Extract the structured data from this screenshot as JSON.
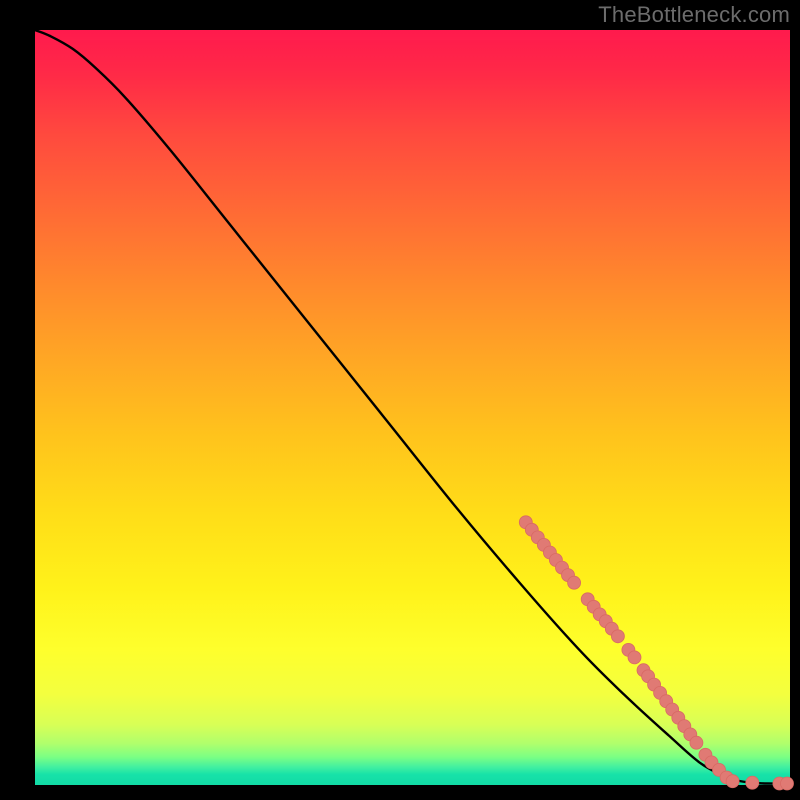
{
  "watermark": "TheBottleneck.com",
  "colors": {
    "dot_fill": "#e07a74",
    "dot_stroke": "#d86a64",
    "curve_stroke": "#000000"
  },
  "chart_data": {
    "type": "line",
    "title": "",
    "xlabel": "",
    "ylabel": "",
    "xlim": [
      0,
      100
    ],
    "ylim": [
      0,
      100
    ],
    "grid": false,
    "legend": false,
    "note": "X axis right = better match; Y axis top = 100% bottleneck. Curve descends from near-100 to 0.",
    "curve_points": [
      {
        "x": 0,
        "y": 100
      },
      {
        "x": 2,
        "y": 99.2
      },
      {
        "x": 5,
        "y": 97.5
      },
      {
        "x": 8,
        "y": 95.0
      },
      {
        "x": 12,
        "y": 91.0
      },
      {
        "x": 18,
        "y": 84.0
      },
      {
        "x": 26,
        "y": 74.0
      },
      {
        "x": 36,
        "y": 61.5
      },
      {
        "x": 46,
        "y": 49.0
      },
      {
        "x": 56,
        "y": 36.5
      },
      {
        "x": 64,
        "y": 27.0
      },
      {
        "x": 72,
        "y": 18.0
      },
      {
        "x": 78,
        "y": 12.0
      },
      {
        "x": 84,
        "y": 6.5
      },
      {
        "x": 88,
        "y": 3.0
      },
      {
        "x": 91,
        "y": 1.3
      },
      {
        "x": 93,
        "y": 0.6
      },
      {
        "x": 95,
        "y": 0.3
      },
      {
        "x": 97,
        "y": 0.2
      },
      {
        "x": 100,
        "y": 0.2
      }
    ],
    "dots": [
      {
        "x": 65.0,
        "y": 34.8
      },
      {
        "x": 65.8,
        "y": 33.8
      },
      {
        "x": 66.6,
        "y": 32.8
      },
      {
        "x": 67.4,
        "y": 31.8
      },
      {
        "x": 68.2,
        "y": 30.8
      },
      {
        "x": 69.0,
        "y": 29.8
      },
      {
        "x": 69.8,
        "y": 28.8
      },
      {
        "x": 70.6,
        "y": 27.8
      },
      {
        "x": 71.4,
        "y": 26.8
      },
      {
        "x": 73.2,
        "y": 24.6
      },
      {
        "x": 74.0,
        "y": 23.6
      },
      {
        "x": 74.8,
        "y": 22.6
      },
      {
        "x": 75.6,
        "y": 21.7
      },
      {
        "x": 76.4,
        "y": 20.7
      },
      {
        "x": 77.2,
        "y": 19.7
      },
      {
        "x": 78.6,
        "y": 17.9
      },
      {
        "x": 79.4,
        "y": 16.9
      },
      {
        "x": 80.6,
        "y": 15.2
      },
      {
        "x": 81.2,
        "y": 14.4
      },
      {
        "x": 82.0,
        "y": 13.3
      },
      {
        "x": 82.8,
        "y": 12.2
      },
      {
        "x": 83.6,
        "y": 11.1
      },
      {
        "x": 84.4,
        "y": 10.0
      },
      {
        "x": 85.2,
        "y": 8.9
      },
      {
        "x": 86.0,
        "y": 7.8
      },
      {
        "x": 86.8,
        "y": 6.7
      },
      {
        "x": 87.6,
        "y": 5.6
      },
      {
        "x": 88.8,
        "y": 4.0
      },
      {
        "x": 89.6,
        "y": 3.0
      },
      {
        "x": 90.6,
        "y": 2.0
      },
      {
        "x": 91.6,
        "y": 1.0
      },
      {
        "x": 92.4,
        "y": 0.5
      },
      {
        "x": 95.0,
        "y": 0.3
      },
      {
        "x": 98.6,
        "y": 0.2
      },
      {
        "x": 99.6,
        "y": 0.2
      }
    ],
    "dot_radius": 6.5
  }
}
